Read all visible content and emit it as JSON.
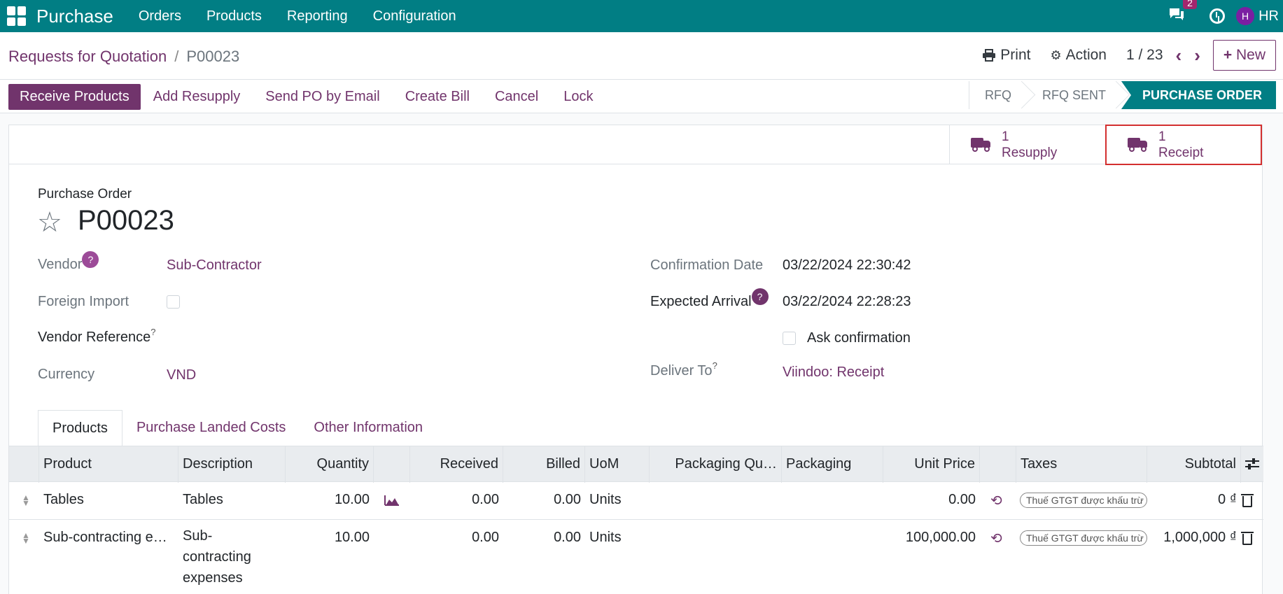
{
  "navbar": {
    "app_name": "Purchase",
    "menu": [
      "Orders",
      "Products",
      "Reporting",
      "Configuration"
    ],
    "chat_badge": "2",
    "avatar_initial": "H",
    "user": "HR"
  },
  "control": {
    "breadcrumb_parent": "Requests for Quotation",
    "breadcrumb_sep": "/",
    "breadcrumb_current": "P00023",
    "print_label": "Print",
    "action_label": "Action",
    "pager": "1 / 23",
    "new_label": "New"
  },
  "statusbar": {
    "actions": [
      "Receive Products",
      "Add Resupply",
      "Send PO by Email",
      "Create Bill",
      "Cancel",
      "Lock"
    ],
    "stages": [
      "RFQ",
      "RFQ SENT",
      "PURCHASE ORDER"
    ],
    "active_stage": "PURCHASE ORDER"
  },
  "smart_buttons": [
    {
      "count": "1",
      "label": "Resupply"
    },
    {
      "count": "1",
      "label": "Receipt"
    }
  ],
  "form": {
    "title_label": "Purchase Order",
    "name": "P00023",
    "vendor_label": "Vendor",
    "vendor": "Sub-Contractor",
    "foreign_import_label": "Foreign Import",
    "vendor_reference_label": "Vendor Reference",
    "currency_label": "Currency",
    "currency": "VND",
    "confirmation_date_label": "Confirmation Date",
    "confirmation_date": "03/22/2024 22:30:42",
    "expected_arrival_label": "Expected Arrival",
    "expected_arrival": "03/22/2024 22:28:23",
    "ask_confirmation_label": "Ask confirmation",
    "deliver_to_label": "Deliver To",
    "deliver_to": "Viindoo: Receipt",
    "help_mark": "?"
  },
  "tabs": [
    "Products",
    "Purchase Landed Costs",
    "Other Information"
  ],
  "table": {
    "columns": [
      "Product",
      "Description",
      "Quantity",
      "Received",
      "Billed",
      "UoM",
      "Packaging Qu…",
      "Packaging",
      "Unit Price",
      "Taxes",
      "Subtotal"
    ],
    "rows": [
      {
        "product": "Tables",
        "description": "Tables",
        "quantity": "10.00",
        "received": "0.00",
        "billed": "0.00",
        "uom": "Units",
        "unit_price": "0.00",
        "tax": "Thuế GTGT được khấu trừ",
        "subtotal": "0 ₫"
      },
      {
        "product": "Sub-contracting e…",
        "description_lines": [
          "Sub-",
          "contracting",
          "expenses"
        ],
        "quantity": "10.00",
        "received": "0.00",
        "billed": "0.00",
        "uom": "Units",
        "unit_price": "100,000.00",
        "tax": "Thuế GTGT được khấu trừ",
        "subtotal": "1,000,000 ₫"
      }
    ]
  },
  "colors": {
    "brand": "#017e84",
    "accent": "#71346c",
    "highlight": "#d32f2f"
  }
}
